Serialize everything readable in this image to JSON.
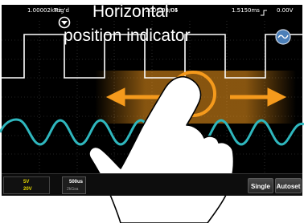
{
  "status": {
    "frequency": "1.00002kHz",
    "trigger": "Trig'd",
    "date": "2000/01/05",
    "time": "09:04",
    "delay": "1.5150ms",
    "trigger_level": "0.00V"
  },
  "channels": {
    "ch1_scale": "5V",
    "ch2_scale": "20V"
  },
  "timebase": {
    "scale": "500us",
    "sample_rate": "2kGsa"
  },
  "buttons": {
    "single": "Single",
    "autoset": "Autoset"
  },
  "callout": {
    "line1": "Horizontal",
    "line2": "position indicator"
  },
  "icons": [
    "scope-grid-icon",
    "down-arrow-indicator-icon",
    "drag-arrows-icon",
    "hand-gesture-icon",
    "network-icon",
    "rising-edge-icon"
  ],
  "colors": {
    "ch1_trace": "#ffffff",
    "ch2_trace": "#2fb7be",
    "highlight": "#f59a1c",
    "ch1_accent": "#e5d800",
    "background": "#000000"
  }
}
